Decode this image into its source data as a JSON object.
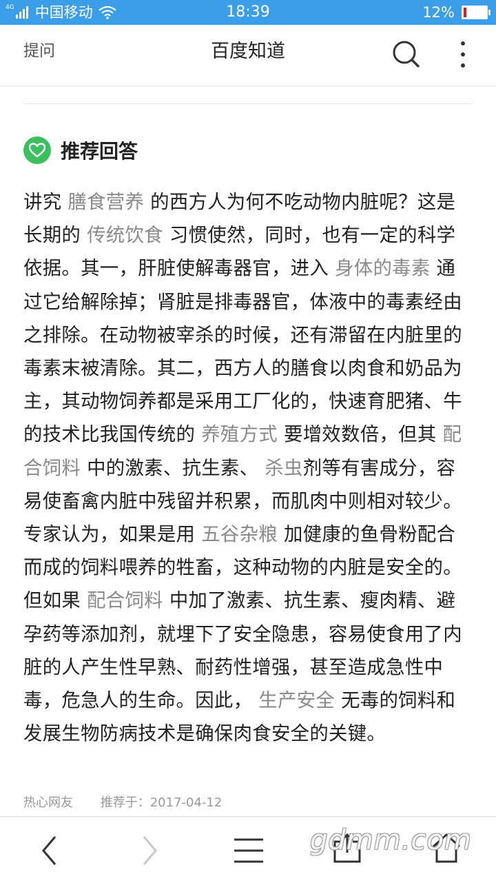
{
  "status_bar": {
    "network": "4G",
    "carrier": "中国移动",
    "time": "18:39",
    "battery_percent": "12%",
    "battery_level": 0.12
  },
  "header": {
    "ask_label": "提问",
    "title": "百度知道",
    "search_icon": "search-icon",
    "more_icon": "more-vertical-icon"
  },
  "answer": {
    "section_title": "推荐回答",
    "heart_icon": "heart-icon",
    "segments": [
      {
        "t": "讲究 ",
        "k": false
      },
      {
        "t": "膳食营养",
        "k": true
      },
      {
        "t": " 的西方人为何不吃动物内脏呢？这是长期的 ",
        "k": false
      },
      {
        "t": "传统饮食",
        "k": true
      },
      {
        "t": " 习惯使然，同时，也有一定的科学依据。其一，肝脏使解毒器官，进入 ",
        "k": false
      },
      {
        "t": "身体的毒素",
        "k": true
      },
      {
        "t": " 通过它给解除掉；肾脏是排毒器官，体液中的毒素经由之排除。在动物被宰杀的时候，还有滞留在内脏里的毒素末被清除。其二，西方人的膳食以肉食和奶品为主，其动物饲养都是采用工厂化的，快速育肥猪、牛的技术比我国传统的 ",
        "k": false
      },
      {
        "t": "养殖方式",
        "k": true
      },
      {
        "t": " 要增效数倍，但其 ",
        "k": false
      },
      {
        "t": "配合饲料",
        "k": true
      },
      {
        "t": " 中的激素、抗生素、 ",
        "k": false
      },
      {
        "t": "杀虫",
        "k": true
      },
      {
        "t": "剂等有害成分，容易使畜禽内脏中残留并积累，而肌肉中则相对较少。专家认为，如果是用 ",
        "k": false
      },
      {
        "t": "五谷杂粮",
        "k": true
      },
      {
        "t": " 加健康的鱼骨粉配合而成的饲料喂养的牲畜，这种动物的内脏是安全的。但如果 ",
        "k": false
      },
      {
        "t": "配合饲料",
        "k": true
      },
      {
        "t": " 中加了激素、抗生素、瘦肉精、避孕药等添加剂，就埋下了安全隐患，容易使食用了内脏的人产生性早熟、耐药性增强，甚至造成急性中毒，危急人的生命。因此， ",
        "k": false
      },
      {
        "t": "生产安全",
        "k": true
      },
      {
        "t": " 无毒的饲料和发展生物防病技术是确保肉食安全的关键。",
        "k": false
      }
    ],
    "author": "热心网友",
    "recommended_at": "推荐于：2017-04-12"
  },
  "bottom_bar": {
    "icons": [
      "back-icon",
      "forward-icon",
      "menu-icon",
      "share-icon",
      "home-icon"
    ],
    "watermark": "gdmm.com"
  }
}
